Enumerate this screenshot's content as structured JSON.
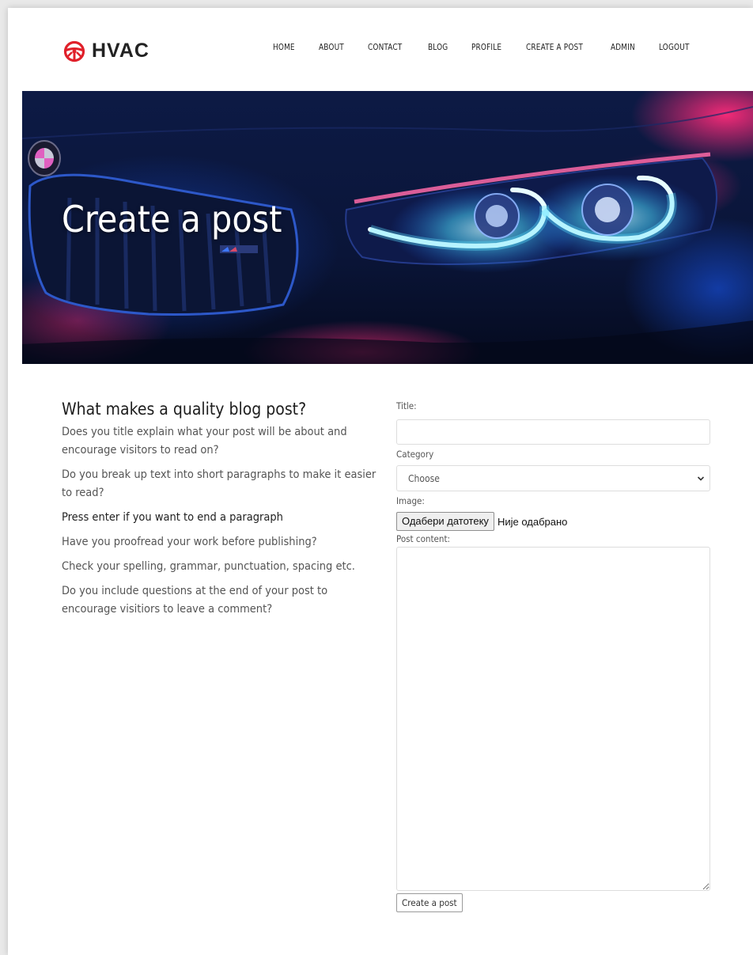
{
  "brand": {
    "name": "HVAC",
    "accent_color": "#e0202a",
    "icon": "steering-wheel-icon"
  },
  "nav": {
    "items": [
      {
        "label": "HOME"
      },
      {
        "label": "ABOUT"
      },
      {
        "label": "CONTACT"
      },
      {
        "label": "BLOG"
      },
      {
        "label": "PROFILE"
      },
      {
        "label": "CREATE A POST"
      },
      {
        "label": "ADMIN"
      },
      {
        "label": "LOGOUT"
      }
    ]
  },
  "hero": {
    "title": "Create a post"
  },
  "tips": {
    "heading": "What makes a quality blog post?",
    "p1": "Does you title explain what your post will be about and encourage visitors to read on?",
    "p2": "Do you break up text into short paragraphs to make it easier to read?",
    "p3": "Press enter if you want to end a paragraph",
    "p4": "Have you proofread your work before publishing?",
    "p5": "Check your spelling, grammar, punctuation, spacing etc.",
    "p6": "Do you include questions at the end of your post to encourage visitiors to leave a comment?"
  },
  "form": {
    "title_label": "Title:",
    "title_value": "",
    "category_label": "Category",
    "category_selected": "Choose",
    "image_label": "Image:",
    "file_button": "Одабери датотеку",
    "file_status": "Није одабрано",
    "content_label": "Post content:",
    "submit_label": "Create a post"
  }
}
